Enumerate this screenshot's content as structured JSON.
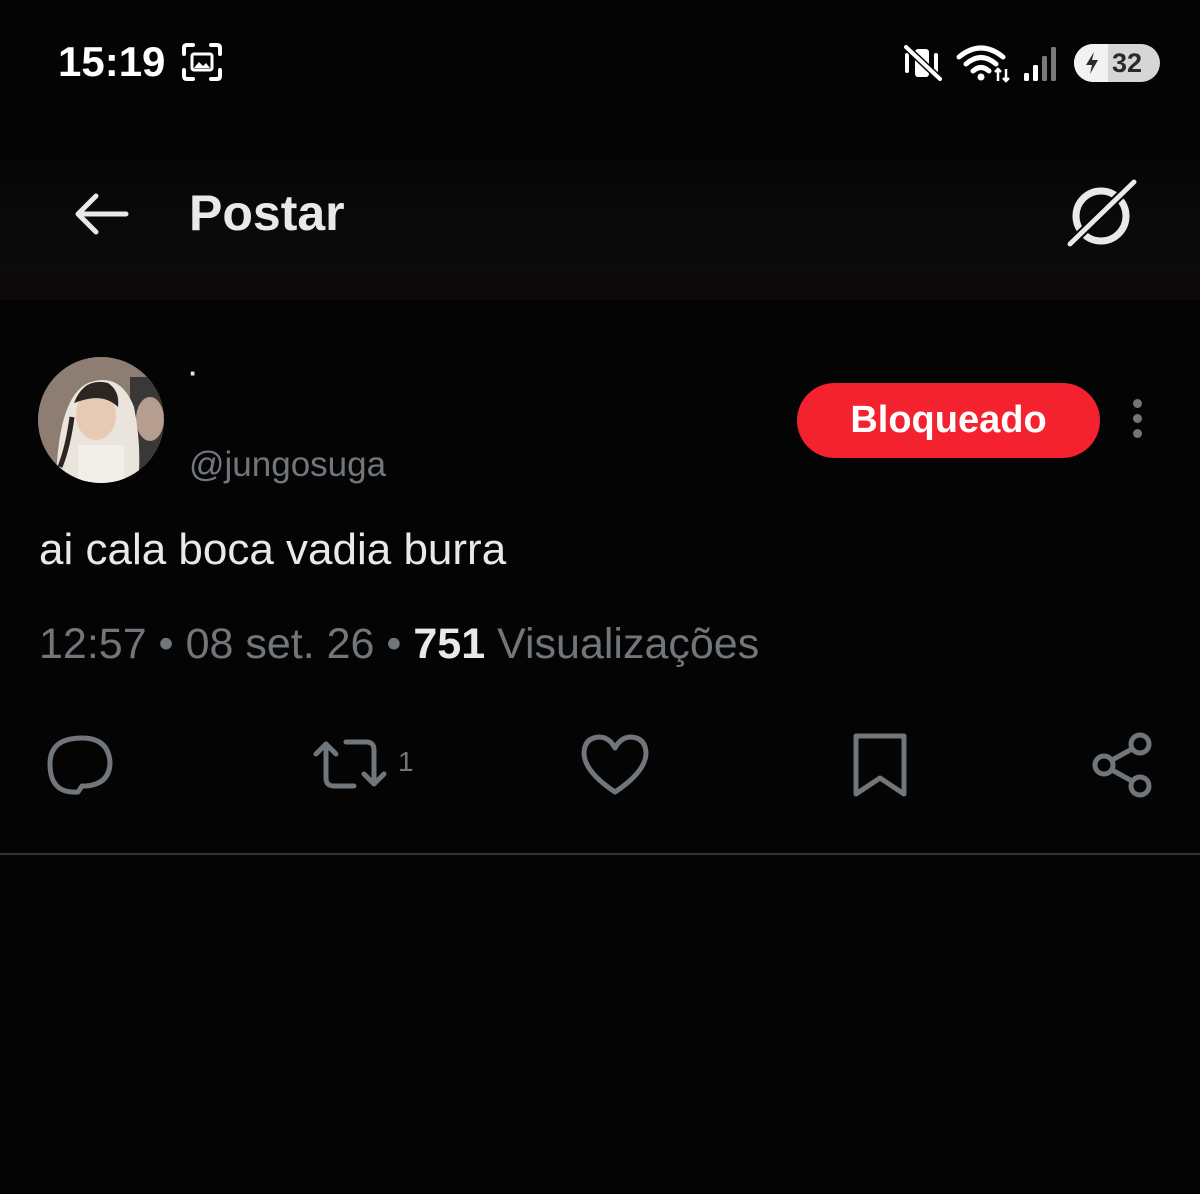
{
  "status_bar": {
    "time": "15:19",
    "battery_level": "32",
    "icons": [
      "screen-recorder-icon",
      "vibrate-mute-icon",
      "wifi-icon",
      "signal-icon",
      "charging-bolt-icon"
    ]
  },
  "header": {
    "back_icon": "arrow-left-icon",
    "title": "Postar",
    "grok_icon": "grok-icon"
  },
  "post": {
    "display_name": "·",
    "handle": "@jungosuga",
    "blocked_label": "Bloqueado",
    "text": "ai cala boca vadia burra",
    "time": "12:57",
    "separator": " • ",
    "date": "08 set. 26",
    "views_count": "751",
    "views_label": " Visualizações"
  },
  "actions": {
    "reply": {
      "icon": "reply-icon",
      "count": ""
    },
    "repost": {
      "icon": "repost-icon",
      "count": "1"
    },
    "like": {
      "icon": "heart-icon",
      "count": ""
    },
    "bookmark": {
      "icon": "bookmark-icon",
      "count": ""
    },
    "share": {
      "icon": "share-icon",
      "count": ""
    }
  },
  "colors": {
    "background": "#040405",
    "text_primary": "#e7e9ea",
    "text_secondary": "#71767b",
    "blocked_red": "#f4212e",
    "divider": "#2f3336"
  }
}
